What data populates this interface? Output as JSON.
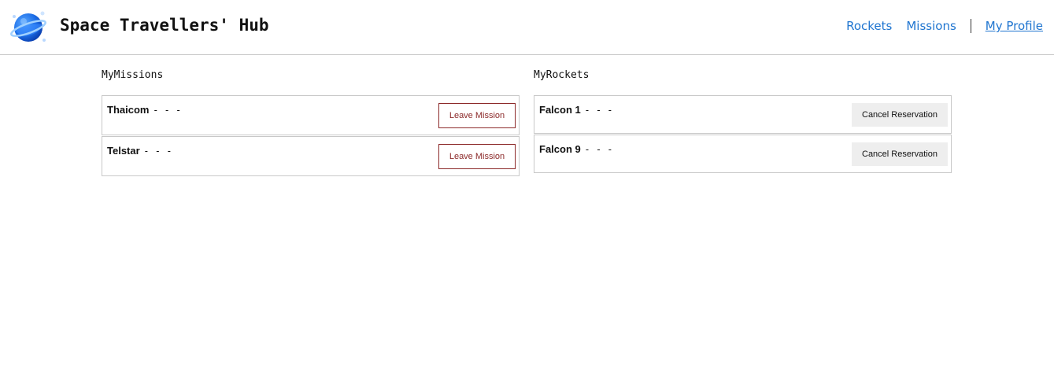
{
  "header": {
    "brand": "Space Travellers' Hub",
    "nav": {
      "rockets": "Rockets",
      "missions": "Missions",
      "profile": "My Profile"
    }
  },
  "missions": {
    "title": "MyMissions",
    "items": [
      {
        "name": "Thaicom",
        "suffix": "- - -",
        "action": "Leave Mission"
      },
      {
        "name": "Telstar",
        "suffix": "- - -",
        "action": "Leave Mission"
      }
    ]
  },
  "rockets": {
    "title": "MyRockets",
    "items": [
      {
        "name": "Falcon 1",
        "suffix": "- - -",
        "action": "Cancel Reservation"
      },
      {
        "name": "Falcon 9",
        "suffix": "- - -",
        "action": "Cancel Reservation"
      }
    ]
  },
  "colors": {
    "nav_link": "#1f75d0",
    "leave_button": "#8c2a2a",
    "cancel_button_bg": "#eeeeee"
  },
  "icons": {
    "logo": "planet-logo-icon"
  }
}
